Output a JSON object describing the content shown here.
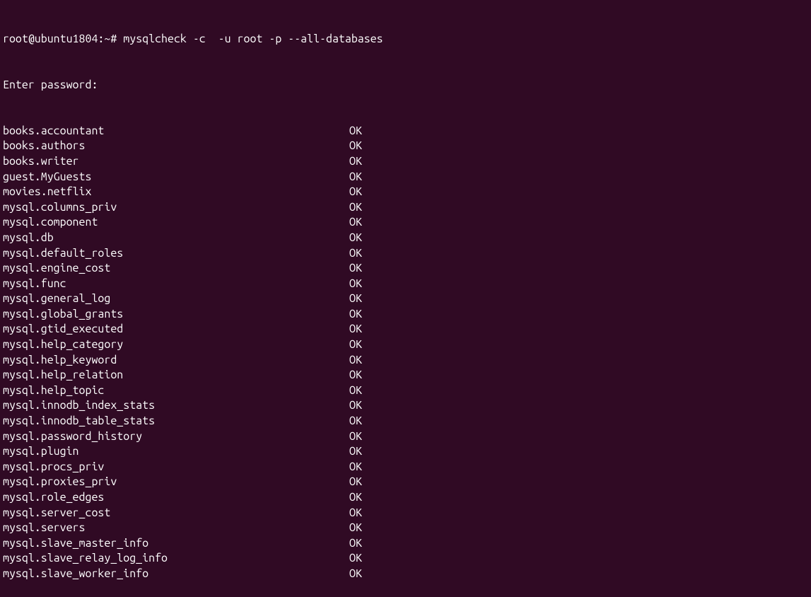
{
  "prompt": {
    "user_host": "root@ubuntu1804",
    "path": "~",
    "symbol": "#",
    "command": "mysqlcheck -c  -u root -p --all-databases"
  },
  "password_prompt": "Enter password:",
  "results": [
    {
      "name": "books.accountant",
      "status": "OK"
    },
    {
      "name": "books.authors",
      "status": "OK"
    },
    {
      "name": "books.writer",
      "status": "OK"
    },
    {
      "name": "guest.MyGuests",
      "status": "OK"
    },
    {
      "name": "movies.netflix",
      "status": "OK"
    },
    {
      "name": "mysql.columns_priv",
      "status": "OK"
    },
    {
      "name": "mysql.component",
      "status": "OK"
    },
    {
      "name": "mysql.db",
      "status": "OK"
    },
    {
      "name": "mysql.default_roles",
      "status": "OK"
    },
    {
      "name": "mysql.engine_cost",
      "status": "OK"
    },
    {
      "name": "mysql.func",
      "status": "OK"
    },
    {
      "name": "mysql.general_log",
      "status": "OK"
    },
    {
      "name": "mysql.global_grants",
      "status": "OK"
    },
    {
      "name": "mysql.gtid_executed",
      "status": "OK"
    },
    {
      "name": "mysql.help_category",
      "status": "OK"
    },
    {
      "name": "mysql.help_keyword",
      "status": "OK"
    },
    {
      "name": "mysql.help_relation",
      "status": "OK"
    },
    {
      "name": "mysql.help_topic",
      "status": "OK"
    },
    {
      "name": "mysql.innodb_index_stats",
      "status": "OK"
    },
    {
      "name": "mysql.innodb_table_stats",
      "status": "OK"
    },
    {
      "name": "mysql.password_history",
      "status": "OK"
    },
    {
      "name": "mysql.plugin",
      "status": "OK"
    },
    {
      "name": "mysql.procs_priv",
      "status": "OK"
    },
    {
      "name": "mysql.proxies_priv",
      "status": "OK"
    },
    {
      "name": "mysql.role_edges",
      "status": "OK"
    },
    {
      "name": "mysql.server_cost",
      "status": "OK"
    },
    {
      "name": "mysql.servers",
      "status": "OK"
    },
    {
      "name": "mysql.slave_master_info",
      "status": "OK"
    },
    {
      "name": "mysql.slave_relay_log_info",
      "status": "OK"
    },
    {
      "name": "mysql.slave_worker_info",
      "status": "OK"
    }
  ]
}
